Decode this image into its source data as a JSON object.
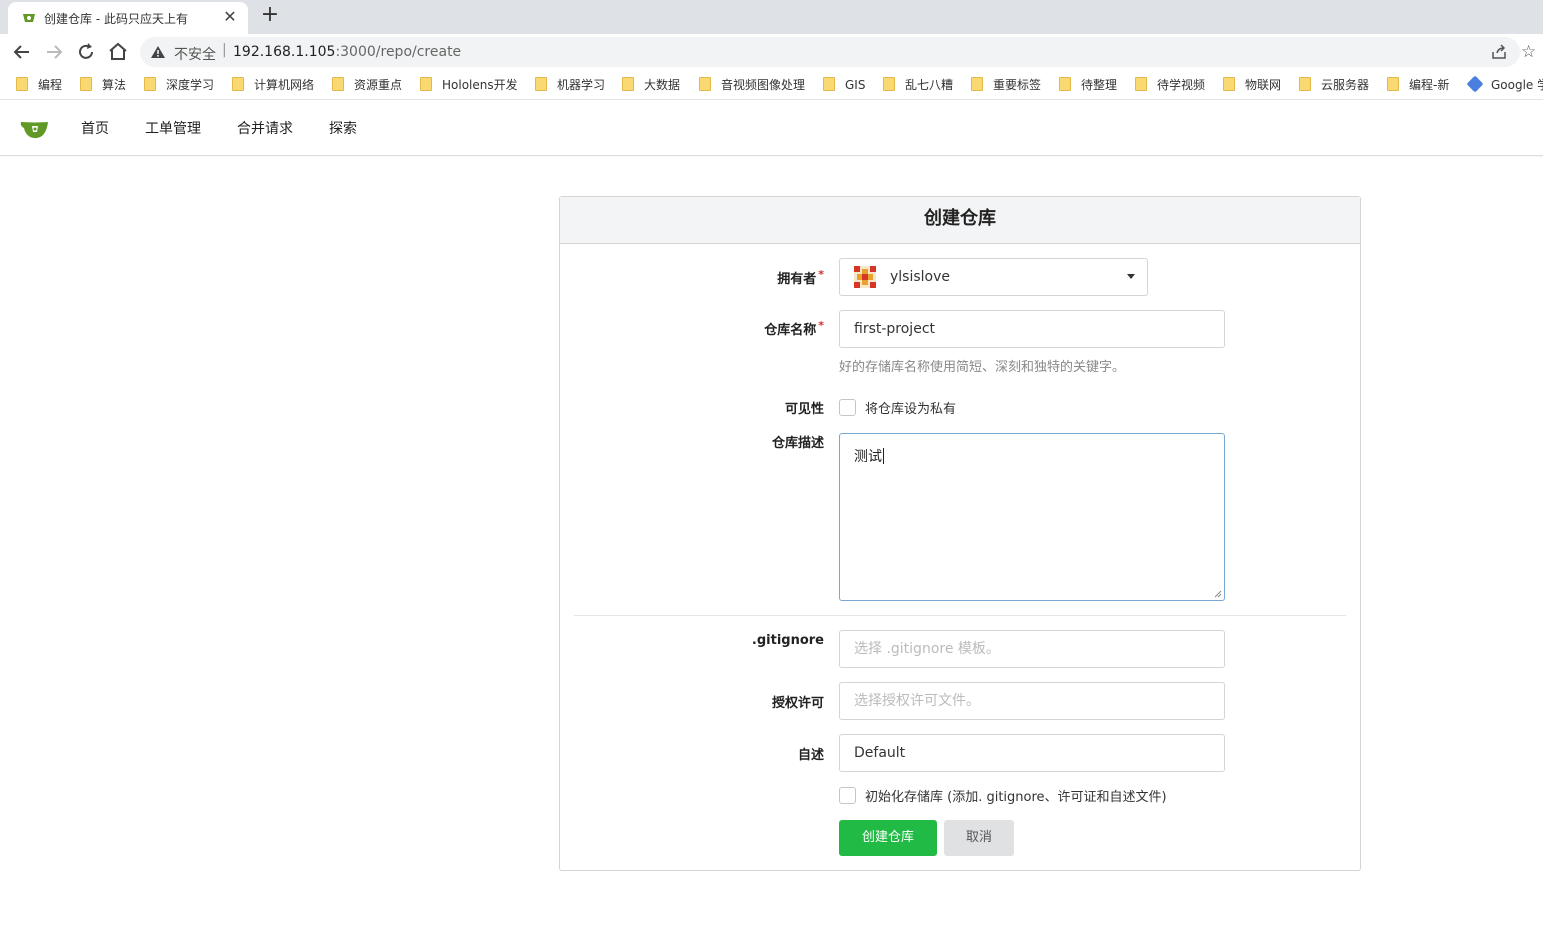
{
  "browser": {
    "tab_title": "创建仓库 - 此码只应天上有",
    "new_tab": "+",
    "close": "✕",
    "insecure_label": "不安全",
    "url_host": "192.168.1.105",
    "url_path": ":3000/repo/create"
  },
  "bookmarks": [
    "编程",
    "算法",
    "深度学习",
    "计算机网络",
    "资源重点",
    "Hololens开发",
    "机器学习",
    "大数据",
    "音视频图像处理",
    "GIS",
    "乱七八糟",
    "重要标签",
    "待整理",
    "待学视频",
    "物联网",
    "云服务器",
    "编程-新",
    "Google 学"
  ],
  "nav": {
    "home": "首页",
    "issues": "工单管理",
    "pulls": "合并请求",
    "explore": "探索"
  },
  "form": {
    "title": "创建仓库",
    "owner_label": "拥有者",
    "owner_value": "ylsislove",
    "required_mark": "*",
    "repo_name_label": "仓库名称",
    "repo_name_value": "first-project",
    "repo_name_help": "好的存储库名称使用简短、深刻和独特的关键字。",
    "visibility_label": "可见性",
    "visibility_checkbox": "将仓库设为私有",
    "visibility_checked": false,
    "description_label": "仓库描述",
    "description_value": "测试",
    "gitignore_label": ".gitignore",
    "gitignore_placeholder": "选择 .gitignore 模板。",
    "license_label": "授权许可",
    "license_placeholder": "选择授权许可文件。",
    "readme_label": "自述",
    "readme_value": "Default",
    "auto_init_label": "初始化存储库 (添加. gitignore、许可证和自述文件)",
    "auto_init_checked": false,
    "create_button": "创建仓库",
    "cancel_button": "取消"
  },
  "colors": {
    "primary": "#21ba45",
    "required": "#db2828",
    "focus_border": "#7aa8d6"
  }
}
